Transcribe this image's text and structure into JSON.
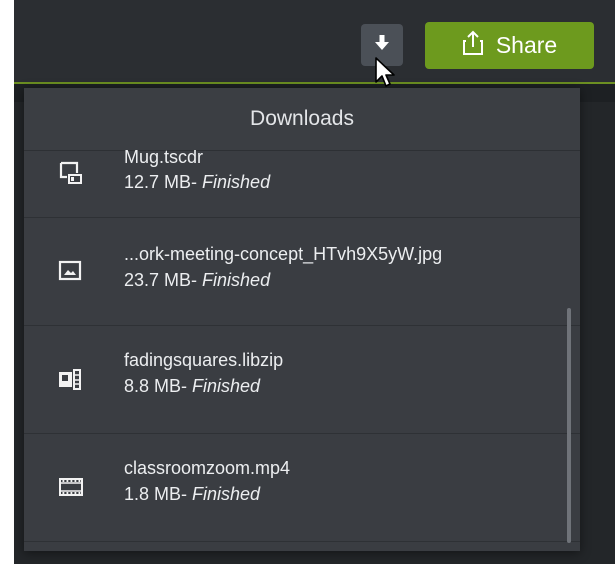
{
  "toolbar": {
    "download_icon": "download-arrow-icon",
    "share_label": "Share",
    "share_icon": "share-upload-icon"
  },
  "downloads": {
    "title": "Downloads",
    "items": [
      {
        "name": "Mug.tscdr",
        "size": "12.7 MB",
        "separator": "- ",
        "status": "Finished",
        "icon": "screen-project-icon"
      },
      {
        "name": "...ork-meeting-concept_HTvh9X5yW.jpg",
        "size": "23.7 MB",
        "separator": "- ",
        "status": "Finished",
        "icon": "image-icon"
      },
      {
        "name": "fadingsquares.libzip",
        "size": "8.8 MB",
        "separator": "- ",
        "status": "Finished",
        "icon": "library-zip-icon"
      },
      {
        "name": "classroomzoom.mp4",
        "size": "1.8 MB",
        "separator": "- ",
        "status": "Finished",
        "icon": "film-icon"
      }
    ]
  },
  "colors": {
    "accent_green": "#6d9a1e",
    "panel_bg": "#3a3d42",
    "topbar_bg": "#2b2e32"
  }
}
